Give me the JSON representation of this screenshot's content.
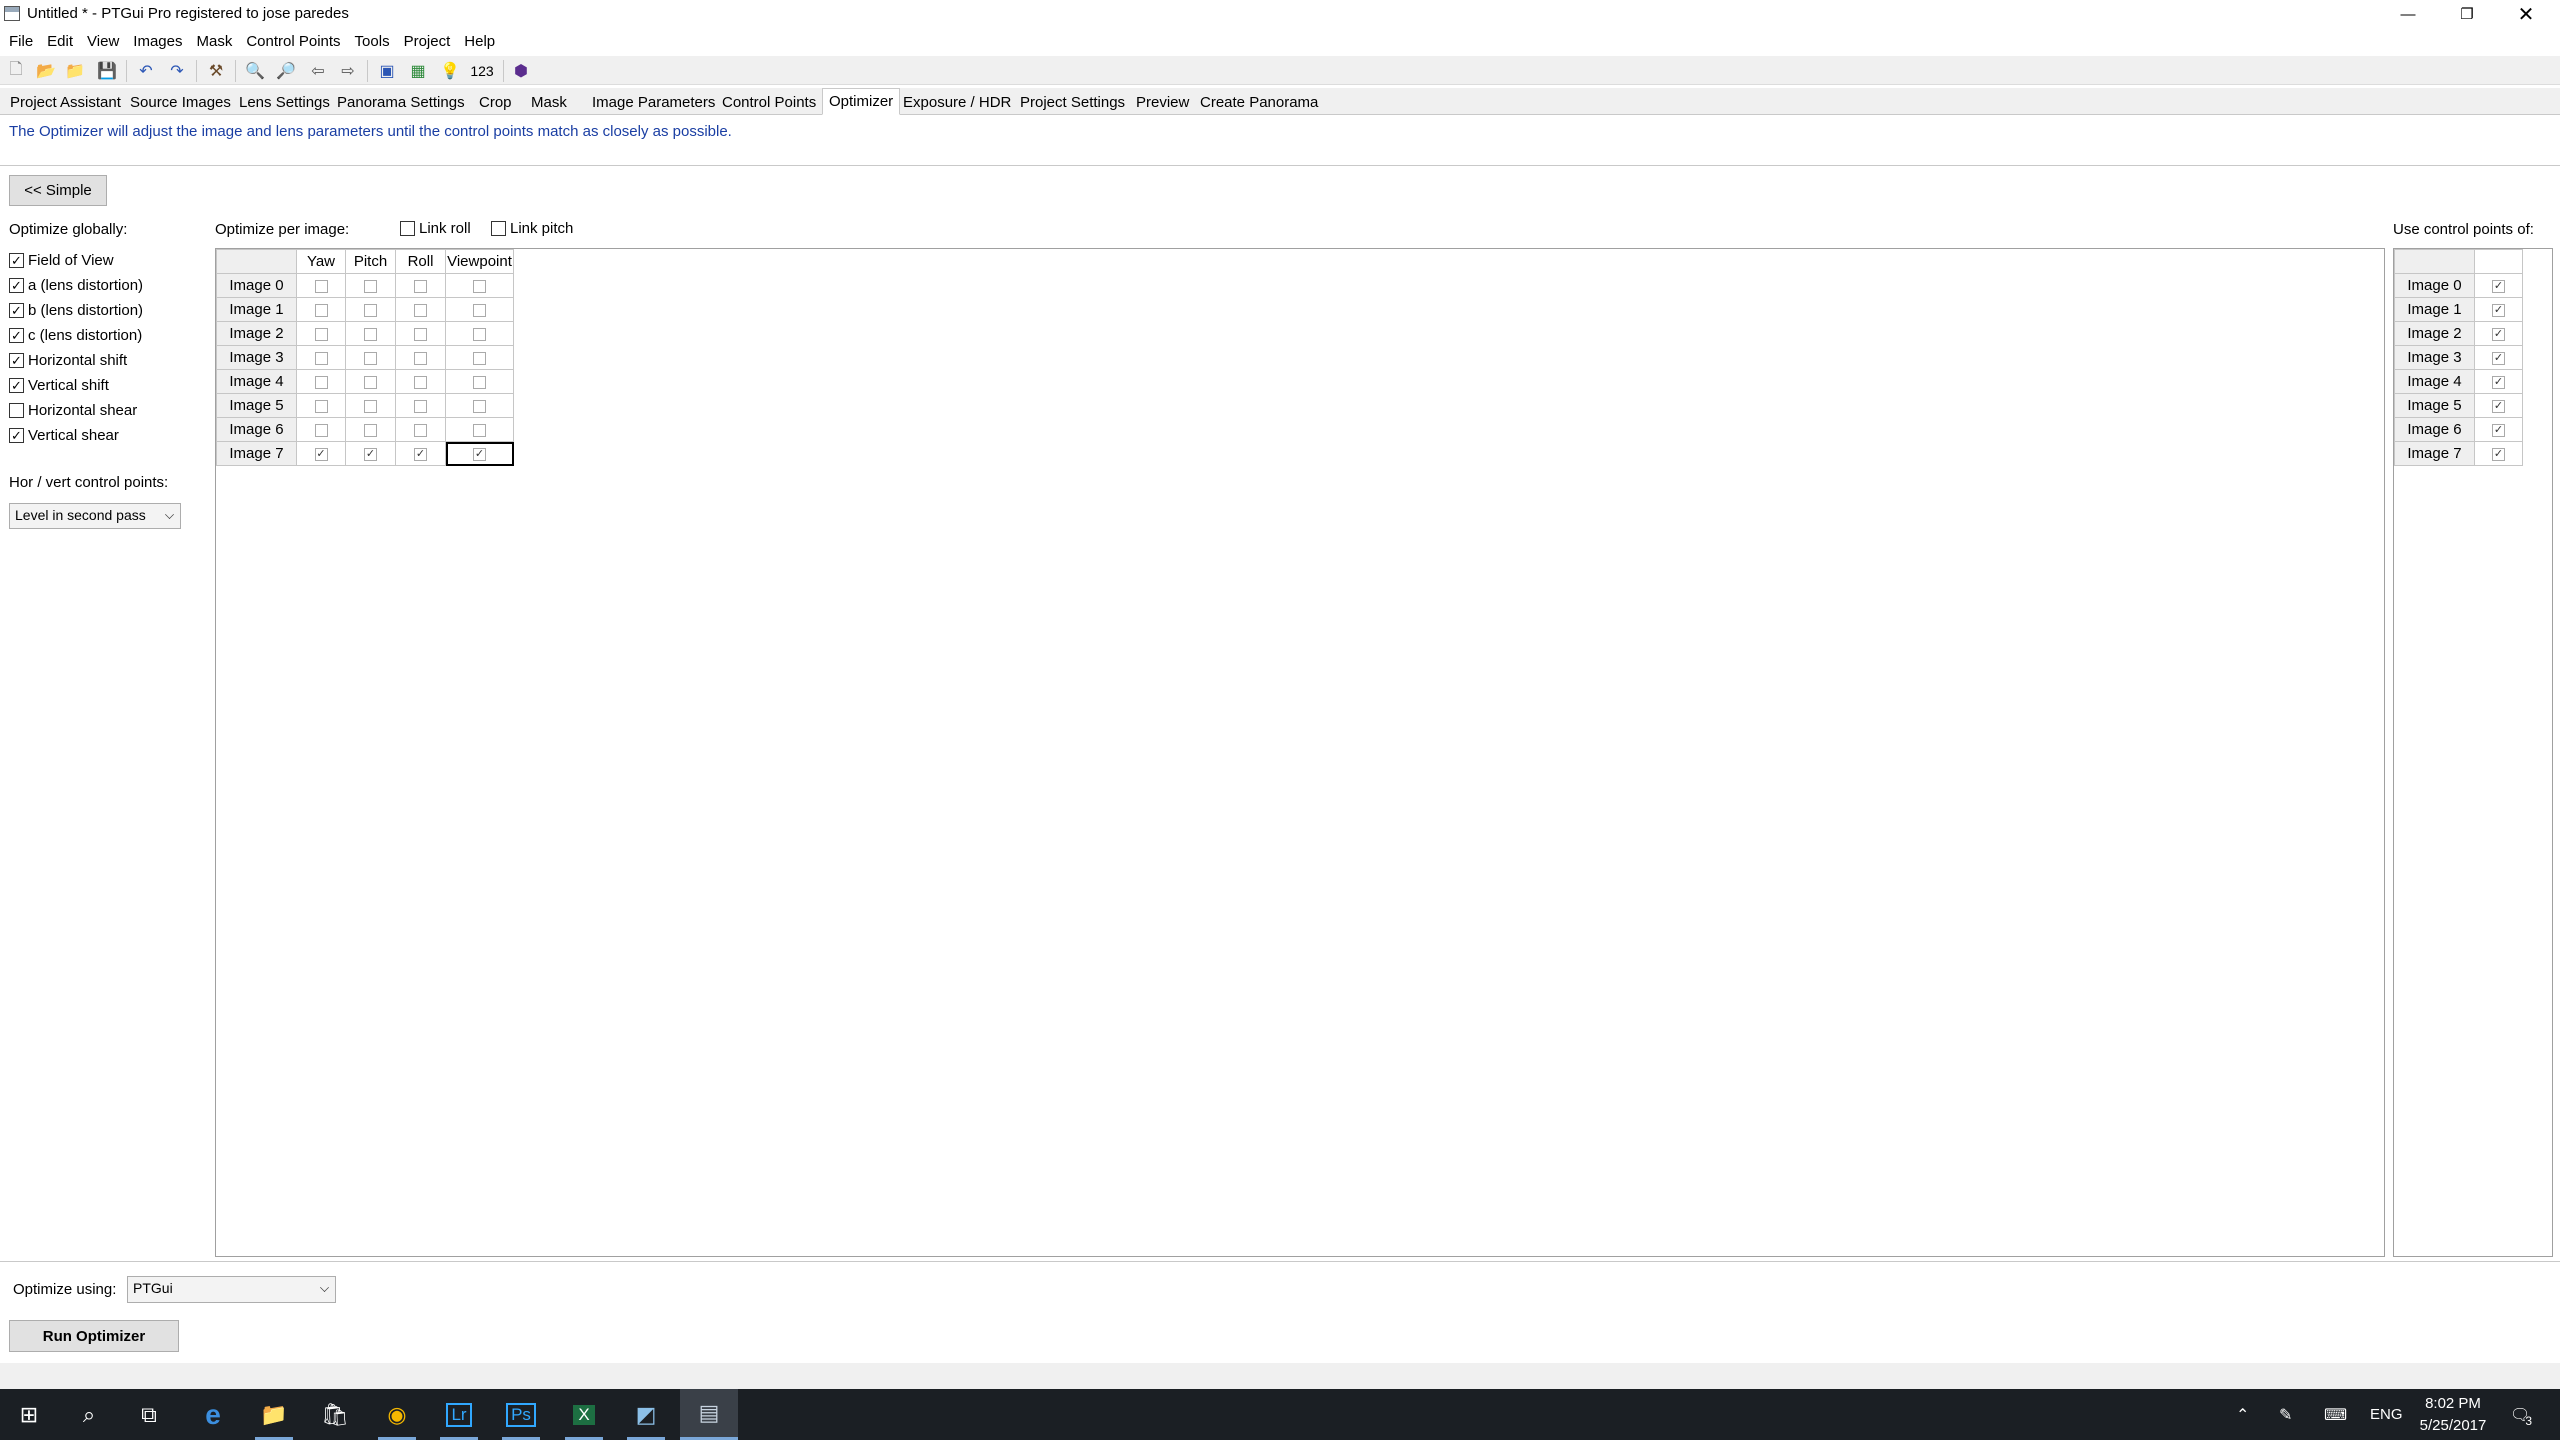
{
  "window": {
    "title": "Untitled * - PTGui Pro registered to jose paredes",
    "minimize_icon": "minimize-icon",
    "restore_icon": "restore-icon",
    "close_icon": "close-icon"
  },
  "menu": [
    "File",
    "Edit",
    "View",
    "Images",
    "Mask",
    "Control Points",
    "Tools",
    "Project",
    "Help"
  ],
  "toolbar": {
    "icons": [
      "new-file-icon",
      "open-icon",
      "open-recent-icon",
      "save-icon",
      "undo-icon",
      "redo-icon",
      "tools-icon",
      "zoom-in-icon",
      "zoom-out-icon",
      "back-icon",
      "forward-icon",
      "panorama-editor-icon",
      "table-icon",
      "lightbulb-icon",
      "numbers-icon",
      "batch-icon"
    ],
    "numbers_label": "123"
  },
  "tabs": [
    "Project Assistant",
    "Source Images",
    "Lens Settings",
    "Panorama Settings",
    "Crop",
    "Mask",
    "Image Parameters",
    "Control Points",
    "Optimizer",
    "Exposure / HDR",
    "Project Settings",
    "Preview",
    "Create Panorama"
  ],
  "active_tab": "Optimizer",
  "description": "The Optimizer will adjust the image and lens parameters until the control points match as closely as possible.",
  "simple_button": "<< Simple",
  "optimize_globally": {
    "label": "Optimize globally:",
    "options": [
      {
        "label": "Field of View",
        "checked": true
      },
      {
        "label": "a (lens distortion)",
        "checked": true
      },
      {
        "label": "b (lens distortion)",
        "checked": true
      },
      {
        "label": "c (lens distortion)",
        "checked": true
      },
      {
        "label": "Horizontal shift",
        "checked": true
      },
      {
        "label": "Vertical shift",
        "checked": true
      },
      {
        "label": "Horizontal shear",
        "checked": false
      },
      {
        "label": "Vertical shear",
        "checked": true
      }
    ]
  },
  "hor_vert": {
    "label": "Hor / vert control points:",
    "selected": "Level in second pass"
  },
  "per_image": {
    "label": "Optimize per image:",
    "link_roll": {
      "label": "Link roll",
      "checked": false
    },
    "link_pitch": {
      "label": "Link pitch",
      "checked": false
    },
    "columns": [
      "Yaw",
      "Pitch",
      "Roll",
      "Viewpoint"
    ],
    "rows": [
      {
        "name": "Image 0",
        "values": [
          false,
          false,
          false,
          false
        ]
      },
      {
        "name": "Image 1",
        "values": [
          false,
          false,
          false,
          false
        ]
      },
      {
        "name": "Image 2",
        "values": [
          false,
          false,
          false,
          false
        ]
      },
      {
        "name": "Image 3",
        "values": [
          false,
          false,
          false,
          false
        ]
      },
      {
        "name": "Image 4",
        "values": [
          false,
          false,
          false,
          false
        ]
      },
      {
        "name": "Image 5",
        "values": [
          false,
          false,
          false,
          false
        ]
      },
      {
        "name": "Image 6",
        "values": [
          false,
          false,
          false,
          false
        ]
      },
      {
        "name": "Image 7",
        "values": [
          true,
          true,
          true,
          true
        ]
      }
    ]
  },
  "control_points": {
    "label": "Use control points of:",
    "rows": [
      {
        "name": "Image 0",
        "checked": true
      },
      {
        "name": "Image 1",
        "checked": true
      },
      {
        "name": "Image 2",
        "checked": true
      },
      {
        "name": "Image 3",
        "checked": true
      },
      {
        "name": "Image 4",
        "checked": true
      },
      {
        "name": "Image 5",
        "checked": true
      },
      {
        "name": "Image 6",
        "checked": true
      },
      {
        "name": "Image 7",
        "checked": true
      }
    ]
  },
  "optimize_using": {
    "label": "Optimize using:",
    "selected": "PTGui"
  },
  "run_button": "Run Optimizer",
  "taskbar": {
    "apps": [
      "start-icon",
      "search-icon",
      "task-view-icon",
      "edge-icon",
      "file-explorer-icon",
      "store-icon",
      "chrome-icon",
      "lightroom-icon",
      "photoshop-icon",
      "excel-icon",
      "app-icon",
      "ptgui-icon"
    ],
    "lightroom_label": "Lr",
    "photoshop_label": "Ps",
    "excel_label": "X",
    "language": "ENG",
    "time": "8:02 PM",
    "date": "5/25/2017",
    "notifications": "3"
  },
  "colors": {
    "description_text": "#1a3ea3",
    "taskbar": "#1b1f24",
    "lightroom": "#31a8ff",
    "photoshop": "#31a8ff",
    "excel": "#1d6f42"
  }
}
